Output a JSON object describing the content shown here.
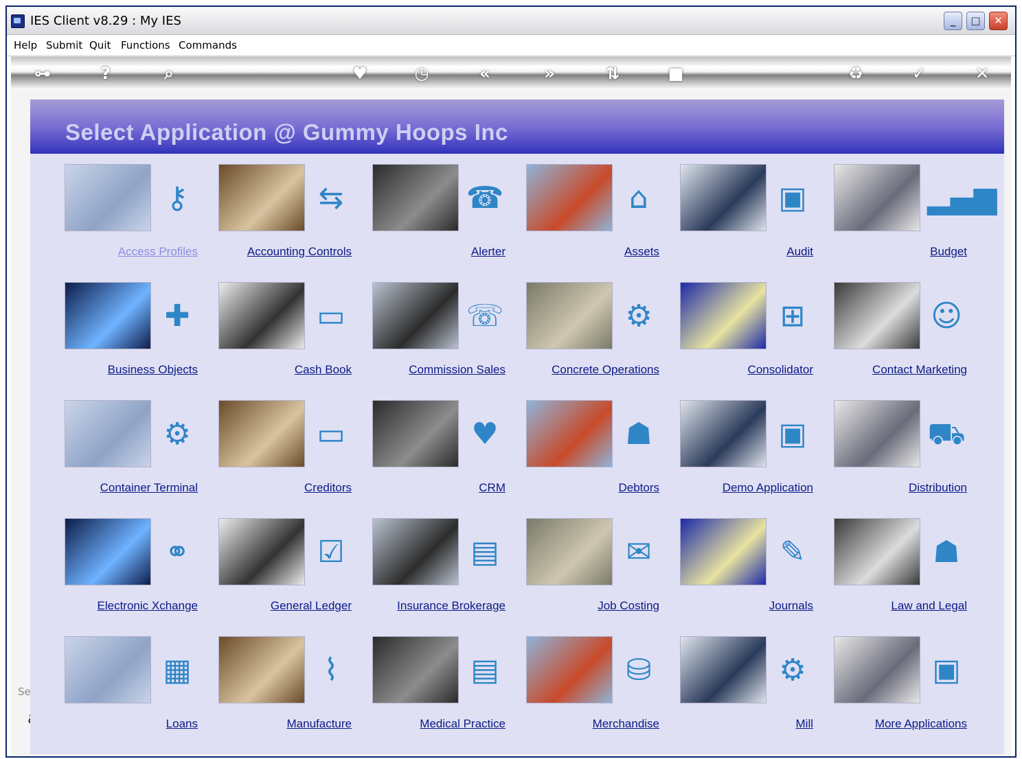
{
  "window": {
    "title": "IES Client v8.29 : My IES",
    "minimize_label": "_",
    "maximize_label": "□",
    "close_label": "✕"
  },
  "menu": {
    "items": [
      "Help",
      "Submit",
      "Quit",
      "Functions",
      "Commands"
    ]
  },
  "toolbar": {
    "icons": [
      "key-icon",
      "help-icon",
      "search-icon",
      "heart-icon",
      "clock-icon",
      "previous-icon",
      "next-icon",
      "sort-icon",
      "stop-icon",
      "recycle-icon",
      "check-icon",
      "close-icon"
    ],
    "glyphs": {
      "key": "⊶",
      "help": "?",
      "search": "⌕",
      "heart": "♥",
      "clock": "◷",
      "previous": "«",
      "next": "»",
      "sort": "⇅",
      "stop": "■",
      "recycle": "♻",
      "check": "✓",
      "close": "✕"
    }
  },
  "panel": {
    "title": "Select Application @  Gummy Hoops Inc"
  },
  "session": {
    "label": "Ses",
    "icon_glyph": "ℰ"
  },
  "apps": [
    {
      "label": "Access Profiles",
      "icon": "key-icon",
      "glyph": "⚷",
      "photo": "map-photo",
      "visited": true
    },
    {
      "label": "Accounting Controls",
      "icon": "transfer-icon",
      "glyph": "⇆",
      "photo": "office-man-photo"
    },
    {
      "label": "Alerter",
      "icon": "router-icon",
      "glyph": "☎",
      "photo": "phone-hands-photo"
    },
    {
      "label": "Assets",
      "icon": "house-icon",
      "glyph": "⌂",
      "photo": "crane-photo"
    },
    {
      "label": "Audit",
      "icon": "monitor-icon",
      "glyph": "▣",
      "photo": "projector-photo"
    },
    {
      "label": "Budget",
      "icon": "bar-chart-icon",
      "glyph": "▂▄▆",
      "photo": "meeting-photo"
    },
    {
      "label": "Business Objects",
      "icon": "puzzle-icon",
      "glyph": "✚",
      "photo": "circuit-photo"
    },
    {
      "label": "Cash Book",
      "icon": "credit-card-icon",
      "glyph": "▭",
      "photo": "signing-photo"
    },
    {
      "label": "Commission Sales",
      "icon": "phone-icon",
      "glyph": "☏",
      "photo": "team-photo"
    },
    {
      "label": "Concrete Operations",
      "icon": "gears-icon",
      "glyph": "⚙",
      "photo": "construction-photo"
    },
    {
      "label": "Consolidator",
      "icon": "org-chart-icon",
      "glyph": "⊞",
      "photo": "graph-photo"
    },
    {
      "label": "Contact Marketing",
      "icon": "people-talk-icon",
      "glyph": "☺",
      "photo": "callcenter-photo"
    },
    {
      "label": "Container Terminal",
      "icon": "gears-icon",
      "glyph": "⚙",
      "photo": "port-crane-photo"
    },
    {
      "label": "Creditors",
      "icon": "credit-card-icon",
      "glyph": "▭",
      "photo": "warehouse-photo"
    },
    {
      "label": "CRM",
      "icon": "heart-plus-icon",
      "glyph": "♥",
      "photo": "headset-woman-photo"
    },
    {
      "label": "Debtors",
      "icon": "group-icon",
      "glyph": "☗",
      "photo": "business-woman-photo"
    },
    {
      "label": "Demo Application",
      "icon": "monitor-icon",
      "glyph": "▣",
      "photo": "globe-photo"
    },
    {
      "label": "Distribution",
      "icon": "truck-icon",
      "glyph": "⛟",
      "photo": "truck-photo"
    },
    {
      "label": "Electronic Xchange",
      "icon": "handshake-icon",
      "glyph": "⚭",
      "photo": "server-rack-photo"
    },
    {
      "label": "General Ledger",
      "icon": "checklist-icon",
      "glyph": "☑",
      "photo": "papers-photo"
    },
    {
      "label": "Insurance Brokerage",
      "icon": "files-icon",
      "glyph": "▤",
      "photo": "insurance-policy-photo"
    },
    {
      "label": "Job Costing",
      "icon": "invoice-icon",
      "glyph": "✉",
      "photo": "factory-photo"
    },
    {
      "label": "Journals",
      "icon": "scroll-icon",
      "glyph": "✎",
      "photo": "calculator-photo"
    },
    {
      "label": "Law and Legal",
      "icon": "crowd-icon",
      "glyph": "☗",
      "photo": "gavel-photo"
    },
    {
      "label": "Loans",
      "icon": "chart-cards-icon",
      "glyph": "▦",
      "photo": "coffee-photo"
    },
    {
      "label": "Manufacture",
      "icon": "pulse-icon",
      "glyph": "⌇",
      "photo": "cleanroom-photo"
    },
    {
      "label": "Medical Practice",
      "icon": "id-cards-icon",
      "glyph": "▤",
      "photo": "medical-photo"
    },
    {
      "label": "Merchandise",
      "icon": "basket-icon",
      "glyph": "⛁",
      "photo": "grocery-photo"
    },
    {
      "label": "Mill",
      "icon": "gears-icon",
      "glyph": "⚙",
      "photo": "smokestack-photo"
    },
    {
      "label": "More Applications",
      "icon": "monitor-icon",
      "glyph": "▣",
      "photo": "globe-photo"
    }
  ],
  "colors": {
    "link": "#0a1a86",
    "visited_link": "#8c8ce0",
    "icon_blue": "#2f86c7",
    "panel_bg": "#e0e0f4",
    "header_start": "#a49bd8",
    "header_end": "#2e33b8"
  }
}
